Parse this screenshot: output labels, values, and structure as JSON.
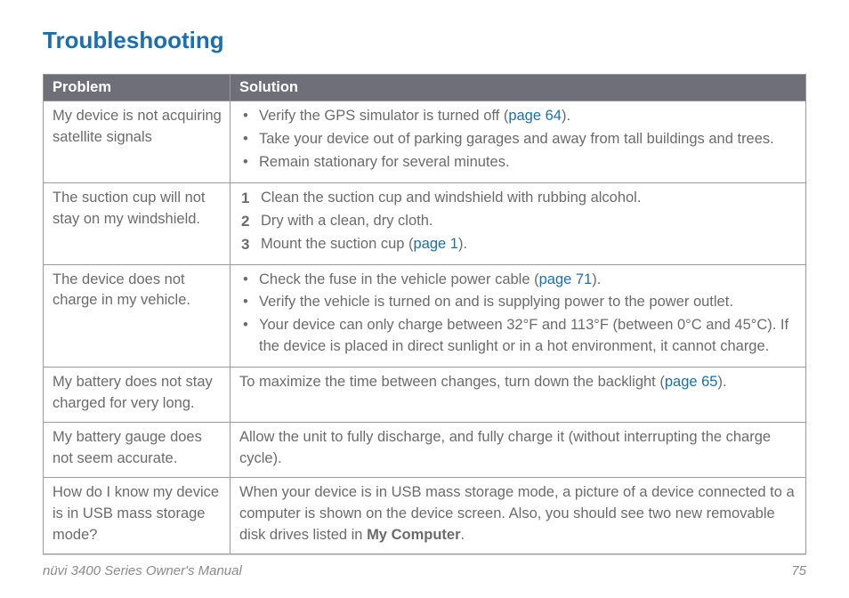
{
  "title": "Troubleshooting",
  "headers": {
    "problem": "Problem",
    "solution": "Solution"
  },
  "rows": {
    "r1": {
      "problem": "My device is not acquiring satellite signals",
      "b1a": "Verify the GPS simulator is turned off (",
      "b1link": "page 64",
      "b1b": ").",
      "b2": "Take your device out of parking garages and away from tall buildings and trees.",
      "b3": "Remain stationary for several minutes."
    },
    "r2": {
      "problem": "The suction cup will not stay on my windshield.",
      "s1": "Clean the suction cup and windshield with rubbing alcohol.",
      "s2": "Dry with a clean, dry cloth.",
      "s3a": "Mount the suction cup (",
      "s3link": "page 1",
      "s3b": ")."
    },
    "r3": {
      "problem": "The device does not charge in my vehicle.",
      "b1a": "Check the fuse in the vehicle power cable (",
      "b1link": "page 71",
      "b1b": ").",
      "b2": "Verify the vehicle is turned on and is supplying power to the power outlet.",
      "b3": "Your device can only charge between 32°F and 113°F (between 0°C and 45°C). If the device is placed in direct sunlight or in a hot environment, it cannot charge."
    },
    "r4": {
      "problem": "My battery does not stay charged for very long.",
      "sa": "To maximize the time between changes, turn down the backlight (",
      "slink": "page 65",
      "sb": ")."
    },
    "r5": {
      "problem": "My battery gauge does not seem accurate.",
      "s": "Allow the unit to fully discharge, and fully charge it (without interrupting the charge cycle)."
    },
    "r6": {
      "problem": "How do I know my device is in USB mass storage mode?",
      "sa": "When your device is in USB mass storage mode, a picture of a device connected to a computer is shown on the device screen. Also, you should see two new removable disk drives listed in ",
      "sbold": "My Computer",
      "sb": "."
    }
  },
  "footer": {
    "manual": "nüvi 3400 Series Owner's Manual",
    "page": "75"
  },
  "chart_data": {
    "type": "table",
    "title": "Troubleshooting",
    "columns": [
      "Problem",
      "Solution"
    ],
    "rows": [
      [
        "My device is not acquiring satellite signals",
        "• Verify the GPS simulator is turned off (page 64). • Take your device out of parking garages and away from tall buildings and trees. • Remain stationary for several minutes."
      ],
      [
        "The suction cup will not stay on my windshield.",
        "1 Clean the suction cup and windshield with rubbing alcohol. 2 Dry with a clean, dry cloth. 3 Mount the suction cup (page 1)."
      ],
      [
        "The device does not charge in my vehicle.",
        "• Check the fuse in the vehicle power cable (page 71). • Verify the vehicle is turned on and is supplying power to the power outlet. • Your device can only charge between 32°F and 113°F (between 0°C and 45°C). If the device is placed in direct sunlight or in a hot environment, it cannot charge."
      ],
      [
        "My battery does not stay charged for very long.",
        "To maximize the time between changes, turn down the backlight (page 65)."
      ],
      [
        "My battery gauge does not seem accurate.",
        "Allow the unit to fully discharge, and fully charge it (without interrupting the charge cycle)."
      ],
      [
        "How do I know my device is in USB mass storage mode?",
        "When your device is in USB mass storage mode, a picture of a device connected to a computer is shown on the device screen. Also, you should see two new removable disk drives listed in My Computer."
      ]
    ]
  }
}
